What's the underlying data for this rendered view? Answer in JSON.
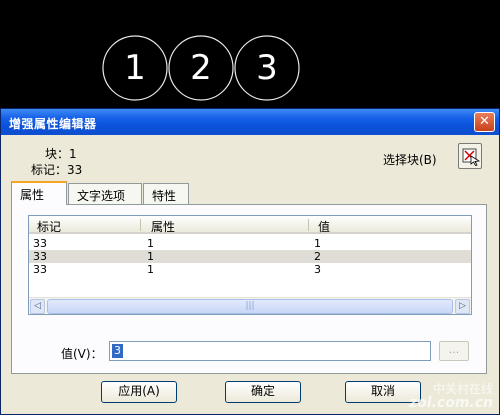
{
  "canvas": {
    "circles": [
      "1",
      "2",
      "3"
    ]
  },
  "dialog": {
    "title": "增强属性编辑器",
    "close_label": "✕",
    "block_label": "块：1",
    "tag_label": "标记：33",
    "select_block_label": "选择块(B)",
    "tabs": [
      "属性",
      "文字选项",
      "特性"
    ],
    "listview": {
      "columns": [
        "标记",
        "属性",
        "值"
      ],
      "rows": [
        [
          "33",
          "1",
          "1"
        ],
        [
          "33",
          "1",
          "2"
        ],
        [
          "33",
          "1",
          "3"
        ]
      ]
    },
    "value_label": "值(V)：",
    "value": "3",
    "ellipsis_label": "...",
    "buttons": {
      "apply": "应用(A)",
      "ok": "确定",
      "cancel": "取消"
    }
  },
  "watermark": {
    "line1": "中关村在线",
    "line2": "zol.com.cn"
  }
}
